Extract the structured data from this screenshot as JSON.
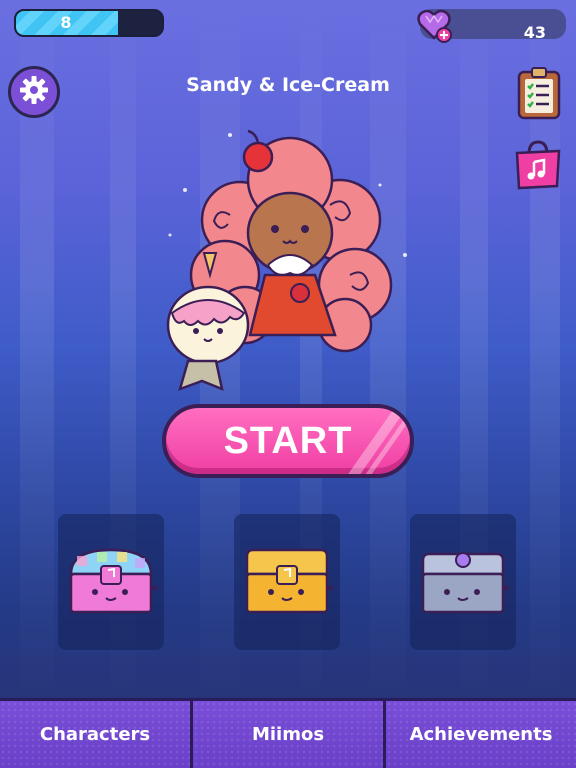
{
  "hud": {
    "level": "8",
    "level_progress": 0.7,
    "gems": "43",
    "gem_icon": "heart-gem-icon"
  },
  "header": {
    "title": "Sandy & Ice-Cream"
  },
  "icons": {
    "settings": "gear-icon",
    "quests": "clipboard-checklist-icon",
    "shop": "music-bag-icon"
  },
  "start_button": {
    "label": "START"
  },
  "chests": [
    {
      "name": "rainbow-chest",
      "color": "#f07ad8"
    },
    {
      "name": "gold-chest",
      "color": "#f4b431"
    },
    {
      "name": "silver-chest",
      "color": "#9aa6c4"
    }
  ],
  "nav": {
    "tabs": [
      {
        "label": "Characters"
      },
      {
        "label": "Miimos"
      },
      {
        "label": "Achievements"
      }
    ]
  },
  "colors": {
    "accent_pink": "#f03fa4",
    "nav_purple": "#6a40c8",
    "progress_blue": "#3fc4f4"
  }
}
